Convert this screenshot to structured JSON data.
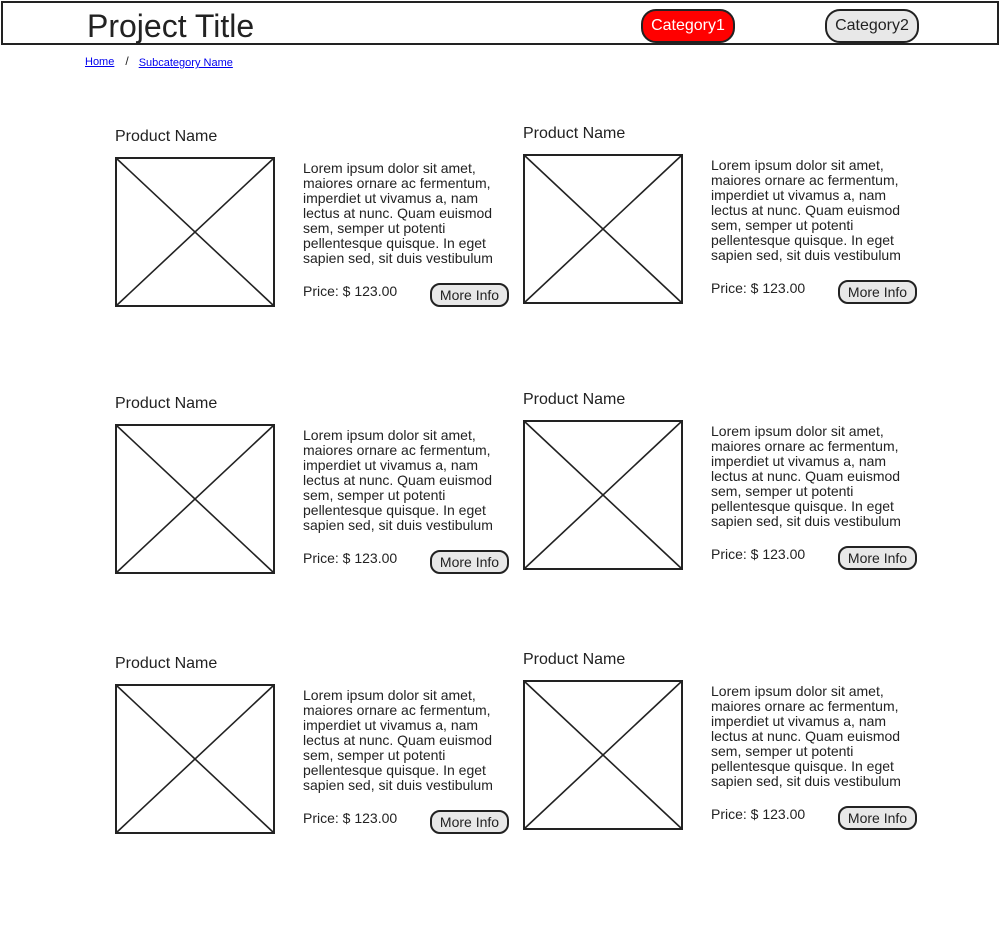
{
  "header": {
    "title": "Project Title",
    "nav": [
      {
        "label": "Category1",
        "active": true,
        "color": "#ff0000"
      },
      {
        "label": "Category2",
        "active": false,
        "color": "#e8e8e8"
      }
    ]
  },
  "breadcrumb": {
    "home": "Home",
    "separator": "/",
    "current": "Subcategory Name"
  },
  "products": [
    {
      "name": "Product Name",
      "image_icon": "image-placeholder-icon",
      "description": "Lorem ipsum dolor sit amet, maiores ornare ac fermentum, imperdiet ut vivamus a, nam lectus at nunc. Quam euismod sem, semper ut potenti pellentesque quisque. In eget sapien sed, sit duis vestibulum",
      "price": "Price: $ 123.00",
      "button": "More Info"
    },
    {
      "name": "Product Name",
      "image_icon": "image-placeholder-icon",
      "description": "Lorem ipsum dolor sit amet, maiores ornare ac fermentum, imperdiet ut vivamus a, nam lectus at nunc. Quam euismod sem, semper ut potenti pellentesque quisque. In eget sapien sed, sit duis vestibulum",
      "price": "Price: $ 123.00",
      "button": "More Info"
    },
    {
      "name": "Product Name",
      "image_icon": "image-placeholder-icon",
      "description": "Lorem ipsum dolor sit amet, maiores ornare ac fermentum, imperdiet ut vivamus a, nam lectus at nunc. Quam euismod sem, semper ut potenti pellentesque quisque. In eget sapien sed, sit duis vestibulum",
      "price": "Price: $ 123.00",
      "button": "More Info"
    },
    {
      "name": "Product Name",
      "image_icon": "image-placeholder-icon",
      "description": "Lorem ipsum dolor sit amet, maiores ornare ac fermentum, imperdiet ut vivamus a, nam lectus at nunc. Quam euismod sem, semper ut potenti pellentesque quisque. In eget sapien sed, sit duis vestibulum",
      "price": "Price: $ 123.00",
      "button": "More Info"
    },
    {
      "name": "Product Name",
      "image_icon": "image-placeholder-icon",
      "description": "Lorem ipsum dolor sit amet, maiores ornare ac fermentum, imperdiet ut vivamus a, nam lectus at nunc. Quam euismod sem, semper ut potenti pellentesque quisque. In eget sapien sed, sit duis vestibulum",
      "price": "Price: $ 123.00",
      "button": "More Info"
    },
    {
      "name": "Product Name",
      "image_icon": "image-placeholder-icon",
      "description": "Lorem ipsum dolor sit amet, maiores ornare ac fermentum, imperdiet ut vivamus a, nam lectus at nunc. Quam euismod sem, semper ut potenti pellentesque quisque. In eget sapien sed, sit duis vestibulum",
      "price": "Price: $ 123.00",
      "button": "More Info"
    }
  ]
}
